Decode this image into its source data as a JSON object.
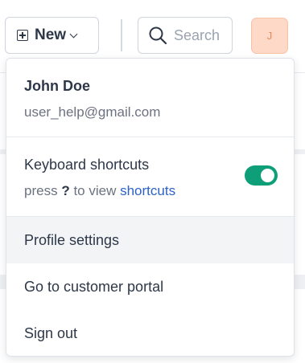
{
  "toolbar": {
    "new_label": "New",
    "search_placeholder": "Search",
    "avatar_initial": "J"
  },
  "user_menu": {
    "name": "John Doe",
    "email": "user_help@gmail.com",
    "shortcuts": {
      "title": "Keyboard shortcuts",
      "hint_prefix": "press",
      "hint_key": "?",
      "hint_middle": "to view",
      "hint_link": "shortcuts",
      "enabled": true
    },
    "items": [
      {
        "label": "Profile settings"
      },
      {
        "label": "Go to customer portal"
      },
      {
        "label": "Sign out"
      }
    ]
  },
  "colors": {
    "toggle_on": "#0e9f78",
    "link": "#2c62c7",
    "avatar_bg": "#ffd9c7",
    "hover_bg": "#f3f4f6"
  }
}
